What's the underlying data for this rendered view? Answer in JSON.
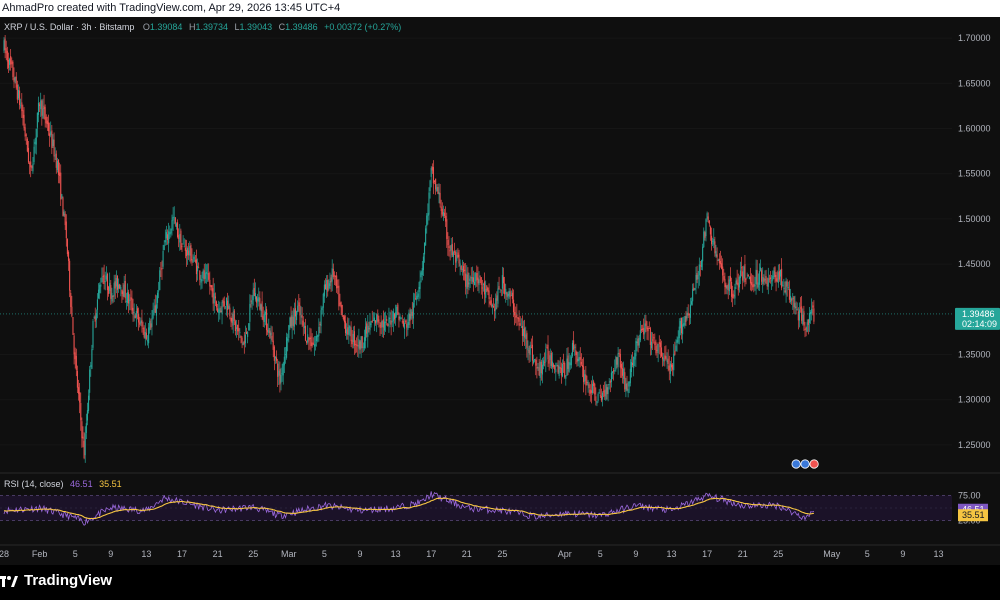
{
  "header": {
    "attribution": "AhmadPro created with TradingView.com, Apr 29, 2026 13:45 UTC+4"
  },
  "legend": {
    "symbol": "XRP / U.S. Dollar · 3h · Bitstamp",
    "open_label": "O",
    "open": "1.39084",
    "high_label": "H",
    "high": "1.39734",
    "low_label": "L",
    "low": "1.39043",
    "close_label": "C",
    "close": "1.39486",
    "change": "+0.00372 (+0.27%)"
  },
  "price_tag": {
    "price": "1.39486",
    "countdown": "02:14:09"
  },
  "rsi": {
    "label": "RSI (14, close)",
    "rsi_value": "46.51",
    "ma_value": "35.51",
    "ticks": [
      "75.00",
      "25.00"
    ]
  },
  "footer": {
    "brand": "TradingView"
  },
  "colors": {
    "up": "#26a69a",
    "down": "#ef5350",
    "rsi_line": "#9c6ade",
    "rsi_ma": "#f5c542",
    "background": "#0f0f0f",
    "price_tag": "#26a69a"
  },
  "chart_data": {
    "type": "candlestick",
    "price_axis": {
      "ticks": [
        "1.70000",
        "1.65000",
        "1.60000",
        "1.55000",
        "1.50000",
        "1.45000",
        "1.35000",
        "1.30000",
        "1.25000"
      ],
      "ylim": [
        1.22,
        1.72
      ]
    },
    "time_axis": {
      "ticks": [
        "28",
        "Feb",
        "5",
        "9",
        "13",
        "17",
        "21",
        "25",
        "Mar",
        "5",
        "9",
        "13",
        "17",
        "21",
        "25",
        "Apr",
        "5",
        "9",
        "13",
        "17",
        "21",
        "25",
        "May",
        "5",
        "9",
        "13"
      ]
    },
    "close_path": [
      [
        "Jan 28",
        1.69
      ],
      [
        "Jan 29",
        1.66
      ],
      [
        "Jan 30",
        1.62
      ],
      [
        "Jan 31",
        1.55
      ],
      [
        "Feb 1",
        1.63
      ],
      [
        "Feb 2",
        1.6
      ],
      [
        "Feb 3",
        1.56
      ],
      [
        "Feb 4",
        1.48
      ],
      [
        "Feb 5",
        1.34
      ],
      [
        "Feb 6",
        1.24
      ],
      [
        "Feb 7",
        1.38
      ],
      [
        "Feb 8",
        1.44
      ],
      [
        "Feb 9",
        1.42
      ],
      [
        "Feb 10",
        1.43
      ],
      [
        "Feb 11",
        1.41
      ],
      [
        "Feb 12",
        1.39
      ],
      [
        "Feb 13",
        1.37
      ],
      [
        "Feb 14",
        1.4
      ],
      [
        "Feb 15",
        1.47
      ],
      [
        "Feb 16",
        1.5
      ],
      [
        "Feb 17",
        1.47
      ],
      [
        "Feb 18",
        1.46
      ],
      [
        "Feb 19",
        1.44
      ],
      [
        "Feb 20",
        1.43
      ],
      [
        "Feb 21",
        1.4
      ],
      [
        "Feb 22",
        1.41
      ],
      [
        "Feb 23",
        1.38
      ],
      [
        "Feb 24",
        1.36
      ],
      [
        "Feb 25",
        1.42
      ],
      [
        "Feb 26",
        1.4
      ],
      [
        "Feb 27",
        1.37
      ],
      [
        "Feb 28",
        1.32
      ],
      [
        "Mar 1",
        1.38
      ],
      [
        "Mar 2",
        1.4
      ],
      [
        "Mar 3",
        1.37
      ],
      [
        "Mar 4",
        1.36
      ],
      [
        "Mar 5",
        1.42
      ],
      [
        "Mar 6",
        1.44
      ],
      [
        "Mar 7",
        1.39
      ],
      [
        "Mar 8",
        1.37
      ],
      [
        "Mar 9",
        1.36
      ],
      [
        "Mar 10",
        1.38
      ],
      [
        "Mar 11",
        1.39
      ],
      [
        "Mar 12",
        1.38
      ],
      [
        "Mar 13",
        1.4
      ],
      [
        "Mar 14",
        1.38
      ],
      [
        "Mar 15",
        1.4
      ],
      [
        "Mar 16",
        1.45
      ],
      [
        "Mar 17",
        1.55
      ],
      [
        "Mar 18",
        1.52
      ],
      [
        "Mar 19",
        1.47
      ],
      [
        "Mar 20",
        1.45
      ],
      [
        "Mar 21",
        1.43
      ],
      [
        "Mar 22",
        1.44
      ],
      [
        "Mar 23",
        1.42
      ],
      [
        "Mar 24",
        1.4
      ],
      [
        "Mar 25",
        1.43
      ],
      [
        "Mar 26",
        1.41
      ],
      [
        "Mar 27",
        1.38
      ],
      [
        "Mar 28",
        1.36
      ],
      [
        "Mar 29",
        1.33
      ],
      [
        "Mar 30",
        1.35
      ],
      [
        "Mar 31",
        1.34
      ],
      [
        "Apr 1",
        1.33
      ],
      [
        "Apr 2",
        1.36
      ],
      [
        "Apr 3",
        1.33
      ],
      [
        "Apr 4",
        1.31
      ],
      [
        "Apr 5",
        1.3
      ],
      [
        "Apr 6",
        1.32
      ],
      [
        "Apr 7",
        1.35
      ],
      [
        "Apr 8",
        1.31
      ],
      [
        "Apr 9",
        1.36
      ],
      [
        "Apr 10",
        1.38
      ],
      [
        "Apr 11",
        1.36
      ],
      [
        "Apr 12",
        1.35
      ],
      [
        "Apr 13",
        1.33
      ],
      [
        "Apr 14",
        1.38
      ],
      [
        "Apr 15",
        1.4
      ],
      [
        "Apr 16",
        1.44
      ],
      [
        "Apr 17",
        1.5
      ],
      [
        "Apr 18",
        1.46
      ],
      [
        "Apr 19",
        1.43
      ],
      [
        "Apr 20",
        1.42
      ],
      [
        "Apr 21",
        1.44
      ],
      [
        "Apr 22",
        1.43
      ],
      [
        "Apr 23",
        1.44
      ],
      [
        "Apr 24",
        1.43
      ],
      [
        "Apr 25",
        1.44
      ],
      [
        "Apr 26",
        1.42
      ],
      [
        "Apr 27",
        1.4
      ],
      [
        "Apr 28",
        1.385
      ],
      [
        "Apr 29",
        1.395
      ]
    ],
    "rsi_path": [
      [
        "Jan 28",
        45
      ],
      [
        "Feb 1",
        50
      ],
      [
        "Feb 5",
        30
      ],
      [
        "Feb 6",
        22
      ],
      [
        "Feb 9",
        50
      ],
      [
        "Feb 13",
        45
      ],
      [
        "Feb 15",
        70
      ],
      [
        "Feb 17",
        62
      ],
      [
        "Feb 21",
        45
      ],
      [
        "Feb 25",
        52
      ],
      [
        "Feb 28",
        35
      ],
      [
        "Mar 5",
        55
      ],
      [
        "Mar 9",
        45
      ],
      [
        "Mar 13",
        50
      ],
      [
        "Mar 16",
        62
      ],
      [
        "Mar 17",
        78
      ],
      [
        "Mar 21",
        50
      ],
      [
        "Mar 25",
        45
      ],
      [
        "Mar 29",
        32
      ],
      [
        "Apr 1",
        40
      ],
      [
        "Apr 5",
        35
      ],
      [
        "Apr 9",
        55
      ],
      [
        "Apr 13",
        45
      ],
      [
        "Apr 17",
        75
      ],
      [
        "Apr 21",
        55
      ],
      [
        "Apr 25",
        55
      ],
      [
        "Apr 28",
        30
      ],
      [
        "Apr 29",
        46.51
      ]
    ]
  }
}
